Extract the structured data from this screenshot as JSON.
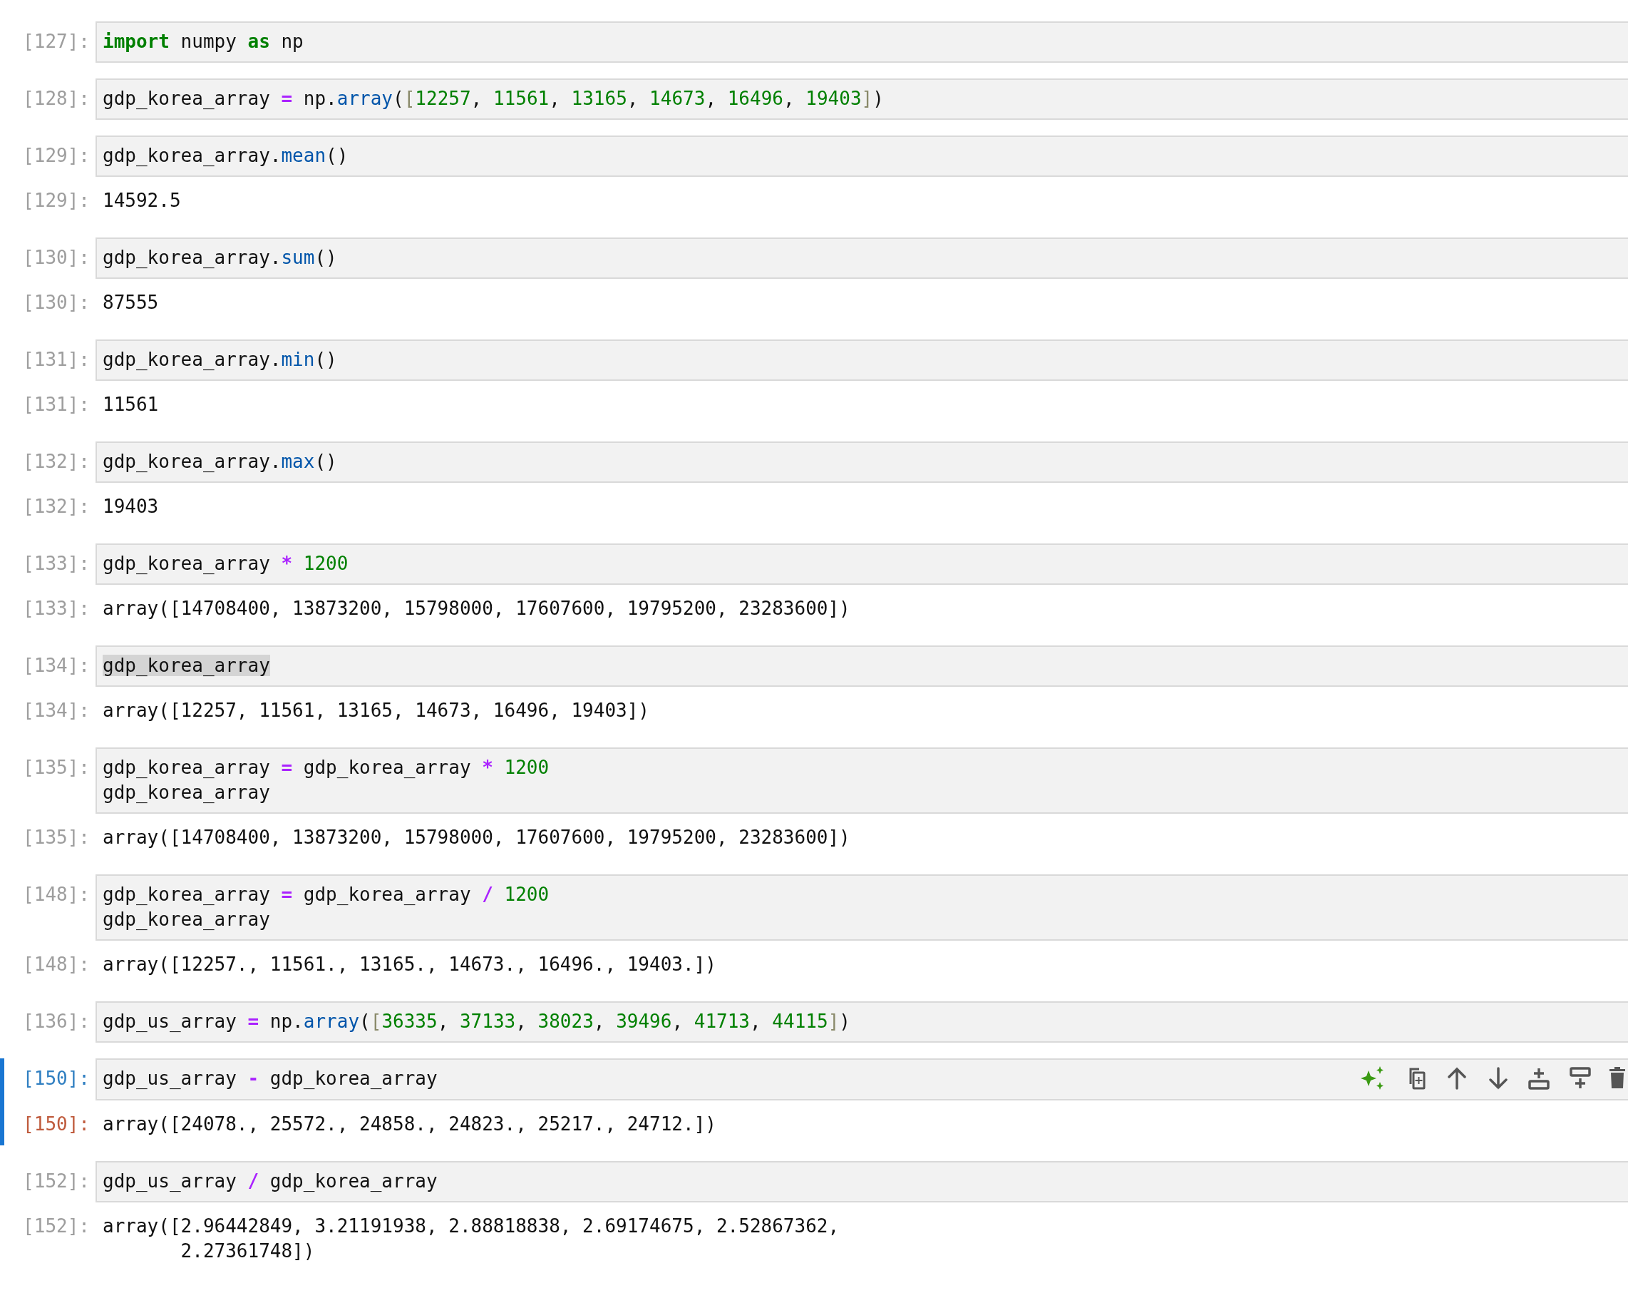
{
  "cells": [
    {
      "prompt": "[127]:",
      "active": false,
      "input": [
        [
          {
            "kind": "keyword",
            "text": "import"
          },
          {
            "kind": "plain",
            "text": " numpy "
          },
          {
            "kind": "keyword",
            "text": "as"
          },
          {
            "kind": "plain",
            "text": " np"
          }
        ]
      ]
    },
    {
      "prompt": "[128]:",
      "active": false,
      "input": [
        [
          {
            "kind": "plain",
            "text": "gdp_korea_array "
          },
          {
            "kind": "operator",
            "text": "="
          },
          {
            "kind": "plain",
            "text": " np."
          },
          {
            "kind": "attribute",
            "text": "array"
          },
          {
            "kind": "plain",
            "text": "("
          },
          {
            "kind": "match",
            "text": "["
          },
          {
            "kind": "number",
            "text": "12257"
          },
          {
            "kind": "plain",
            "text": ", "
          },
          {
            "kind": "number",
            "text": "11561"
          },
          {
            "kind": "plain",
            "text": ", "
          },
          {
            "kind": "number",
            "text": "13165"
          },
          {
            "kind": "plain",
            "text": ", "
          },
          {
            "kind": "number",
            "text": "14673"
          },
          {
            "kind": "plain",
            "text": ", "
          },
          {
            "kind": "number",
            "text": "16496"
          },
          {
            "kind": "plain",
            "text": ", "
          },
          {
            "kind": "number",
            "text": "19403"
          },
          {
            "kind": "match",
            "text": "]"
          },
          {
            "kind": "plain",
            "text": ")"
          }
        ]
      ]
    },
    {
      "prompt": "[129]:",
      "active": false,
      "input": [
        [
          {
            "kind": "plain",
            "text": "gdp_korea_array."
          },
          {
            "kind": "attribute",
            "text": "mean"
          },
          {
            "kind": "plain",
            "text": "()"
          }
        ]
      ],
      "output": {
        "prompt": "[129]:",
        "lines": [
          "14592.5"
        ]
      }
    },
    {
      "prompt": "[130]:",
      "active": false,
      "input": [
        [
          {
            "kind": "plain",
            "text": "gdp_korea_array."
          },
          {
            "kind": "attribute",
            "text": "sum"
          },
          {
            "kind": "plain",
            "text": "()"
          }
        ]
      ],
      "output": {
        "prompt": "[130]:",
        "lines": [
          "87555"
        ]
      }
    },
    {
      "prompt": "[131]:",
      "active": false,
      "input": [
        [
          {
            "kind": "plain",
            "text": "gdp_korea_array."
          },
          {
            "kind": "attribute",
            "text": "min"
          },
          {
            "kind": "plain",
            "text": "()"
          }
        ]
      ],
      "output": {
        "prompt": "[131]:",
        "lines": [
          "11561"
        ]
      }
    },
    {
      "prompt": "[132]:",
      "active": false,
      "input": [
        [
          {
            "kind": "plain",
            "text": "gdp_korea_array."
          },
          {
            "kind": "attribute",
            "text": "max"
          },
          {
            "kind": "plain",
            "text": "()"
          }
        ]
      ],
      "output": {
        "prompt": "[132]:",
        "lines": [
          "19403"
        ]
      }
    },
    {
      "prompt": "[133]:",
      "active": false,
      "input": [
        [
          {
            "kind": "plain",
            "text": "gdp_korea_array "
          },
          {
            "kind": "operator",
            "text": "* "
          },
          {
            "kind": "number",
            "text": "1200"
          }
        ]
      ],
      "output": {
        "prompt": "[133]:",
        "lines": [
          "array([14708400, 13873200, 15798000, 17607600, 19795200, 23283600])"
        ]
      }
    },
    {
      "prompt": "[134]:",
      "active": false,
      "input": [
        [
          {
            "kind": "highlight",
            "text": "gdp_korea_array"
          }
        ]
      ],
      "output": {
        "prompt": "[134]:",
        "lines": [
          "array([12257, 11561, 13165, 14673, 16496, 19403])"
        ]
      }
    },
    {
      "prompt": "[135]:",
      "active": false,
      "input": [
        [
          {
            "kind": "plain",
            "text": "gdp_korea_array "
          },
          {
            "kind": "operator",
            "text": "="
          },
          {
            "kind": "plain",
            "text": " gdp_korea_array "
          },
          {
            "kind": "operator",
            "text": "* "
          },
          {
            "kind": "number",
            "text": "1200"
          }
        ],
        [
          {
            "kind": "plain",
            "text": "gdp_korea_array"
          }
        ]
      ],
      "output": {
        "prompt": "[135]:",
        "lines": [
          "array([14708400, 13873200, 15798000, 17607600, 19795200, 23283600])"
        ]
      }
    },
    {
      "prompt": "[148]:",
      "active": false,
      "input": [
        [
          {
            "kind": "plain",
            "text": "gdp_korea_array "
          },
          {
            "kind": "operator",
            "text": "="
          },
          {
            "kind": "plain",
            "text": " gdp_korea_array "
          },
          {
            "kind": "operator",
            "text": "/ "
          },
          {
            "kind": "number",
            "text": "1200"
          }
        ],
        [
          {
            "kind": "plain",
            "text": "gdp_korea_array"
          }
        ]
      ],
      "output": {
        "prompt": "[148]:",
        "lines": [
          "array([12257., 11561., 13165., 14673., 16496., 19403.])"
        ]
      }
    },
    {
      "prompt": "[136]:",
      "active": false,
      "input": [
        [
          {
            "kind": "plain",
            "text": "gdp_us_array "
          },
          {
            "kind": "operator",
            "text": "="
          },
          {
            "kind": "plain",
            "text": " np."
          },
          {
            "kind": "attribute",
            "text": "array"
          },
          {
            "kind": "plain",
            "text": "("
          },
          {
            "kind": "match",
            "text": "["
          },
          {
            "kind": "number",
            "text": "36335"
          },
          {
            "kind": "plain",
            "text": ", "
          },
          {
            "kind": "number",
            "text": "37133"
          },
          {
            "kind": "plain",
            "text": ", "
          },
          {
            "kind": "number",
            "text": "38023"
          },
          {
            "kind": "plain",
            "text": ", "
          },
          {
            "kind": "number",
            "text": "39496"
          },
          {
            "kind": "plain",
            "text": ", "
          },
          {
            "kind": "number",
            "text": "41713"
          },
          {
            "kind": "plain",
            "text": ", "
          },
          {
            "kind": "number",
            "text": "44115"
          },
          {
            "kind": "match",
            "text": "]"
          },
          {
            "kind": "plain",
            "text": ")"
          }
        ]
      ]
    },
    {
      "prompt": "[150]:",
      "active": true,
      "input": [
        [
          {
            "kind": "plain",
            "text": "gdp_us_array "
          },
          {
            "kind": "operator",
            "text": "-"
          },
          {
            "kind": "plain",
            "text": " gdp_korea_array"
          }
        ]
      ],
      "output": {
        "prompt": "[150]:",
        "lines": [
          "array([24078., 25572., 24858., 24823., 25217., 24712.])"
        ]
      }
    },
    {
      "prompt": "[152]:",
      "active": false,
      "input": [
        [
          {
            "kind": "plain",
            "text": "gdp_us_array "
          },
          {
            "kind": "operator",
            "text": "/"
          },
          {
            "kind": "plain",
            "text": " gdp_korea_array"
          }
        ]
      ],
      "output": {
        "prompt": "[152]:",
        "lines": [
          "array([2.96442849, 3.21191938, 2.88818838, 2.69174675, 2.52867362,",
          "       2.27361748])"
        ]
      }
    }
  ]
}
